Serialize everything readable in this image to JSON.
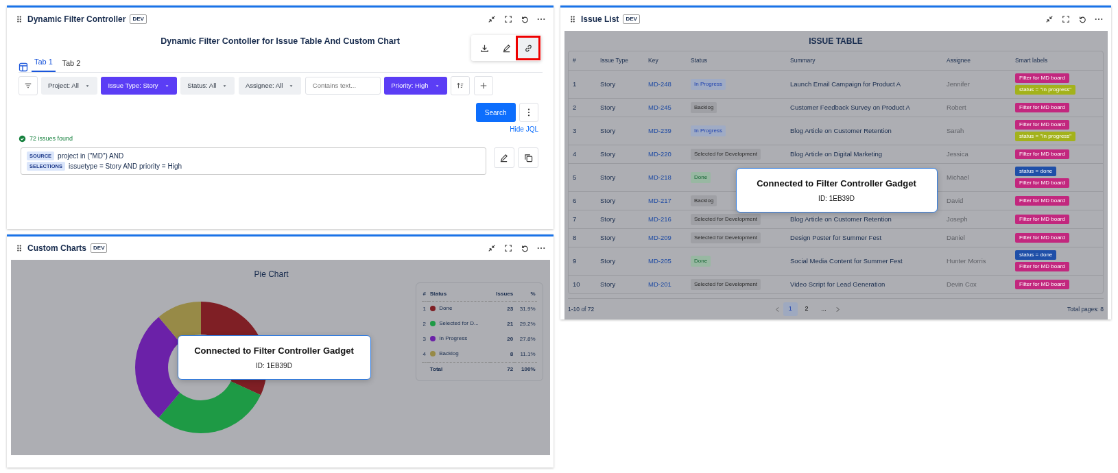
{
  "filter_panel": {
    "title": "Dynamic Filter Controller",
    "badge": "DEV",
    "heading": "Dynamic Filter Contoller for Issue Table And Custom Chart",
    "toolbar_buttons": [
      {
        "kind": "download",
        "highlighted": false
      },
      {
        "kind": "edit",
        "highlighted": false
      },
      {
        "kind": "link",
        "highlighted": true
      }
    ],
    "tabs": [
      {
        "label": "Tab 1",
        "selected": true
      },
      {
        "label": "Tab 2",
        "selected": false
      }
    ],
    "filters": [
      {
        "kind": "dropdown",
        "label": "Project: All",
        "active": false
      },
      {
        "kind": "dropdown",
        "label": "Issue Type: Story",
        "active": true
      },
      {
        "kind": "dropdown",
        "label": "Status: All",
        "active": false
      },
      {
        "kind": "dropdown",
        "label": "Assignee: All",
        "active": false
      },
      {
        "kind": "text",
        "placeholder": "Contains text..."
      },
      {
        "kind": "dropdown",
        "label": "Priority: High",
        "active": true
      }
    ],
    "search_button": "Search",
    "hide_jql": "Hide JQL",
    "result": "72 issues found",
    "jql": [
      {
        "tag": "SOURCE",
        "text": "project in (\"MD\") AND"
      },
      {
        "tag": "SELECTIONS",
        "text": "issuetype = Story AND priority = High"
      }
    ]
  },
  "chart_panel": {
    "title": "Custom Charts",
    "badge": "DEV",
    "chart_data": {
      "type": "donut",
      "title": "Pie Chart",
      "categories": [
        "Done",
        "Selected for D...",
        "In Progress",
        "Backlog"
      ],
      "values": [
        31.9,
        29.2,
        27.8,
        11.1
      ]
    },
    "legend": {
      "columns": [
        "#",
        "Status",
        "Issues",
        "%"
      ],
      "rows": [
        {
          "n": "1",
          "issues": "23",
          "pct": "31.9%",
          "color": "#7f1f25"
        },
        {
          "n": "2",
          "issues": "21",
          "pct": "29.2%",
          "color": "#1e9a45"
        },
        {
          "n": "3",
          "issues": "20",
          "pct": "27.8%",
          "color": "#6b21a8"
        },
        {
          "n": "4",
          "issues": "8",
          "pct": "11.1%",
          "color": "#978a47"
        }
      ],
      "total": {
        "label": "Total",
        "issues": "72",
        "pct": "100%"
      }
    },
    "overlay": {
      "title": "Connected to Filter Controller Gadget",
      "id": "ID: 1EB39D"
    }
  },
  "issue_panel": {
    "title": "Issue List",
    "badge": "DEV",
    "table_title": "ISSUE TABLE",
    "columns": [
      "#",
      "Issue Type",
      "Key",
      "Status",
      "Summary",
      "Assignee",
      "Smart labels"
    ],
    "rows": [
      {
        "n": "1",
        "type": "Story",
        "key": "MD-248",
        "status": {
          "text": "In Progress",
          "kind": "progress"
        },
        "summary": "Launch Email Campaign for Product A",
        "assignee": "Jennifer",
        "labels": [
          {
            "text": "Filter for MD board",
            "color": "#c2277e"
          },
          {
            "text": "status = \"In progress\"",
            "color": "#a3b21b"
          }
        ]
      },
      {
        "n": "2",
        "type": "Story",
        "key": "MD-245",
        "status": {
          "text": "Backlog",
          "kind": "todo"
        },
        "summary": "Customer Feedback Survey on Product A",
        "assignee": "Robert",
        "labels": [
          {
            "text": "Filter for MD board",
            "color": "#c2277e"
          }
        ]
      },
      {
        "n": "3",
        "type": "Story",
        "key": "MD-239",
        "status": {
          "text": "In Progress",
          "kind": "progress"
        },
        "summary": "Blog Article on Customer Retention",
        "assignee": "Sarah",
        "labels": [
          {
            "text": "Filter for MD board",
            "color": "#c2277e"
          },
          {
            "text": "status = \"In progress\"",
            "color": "#a3b21b"
          }
        ]
      },
      {
        "n": "4",
        "type": "Story",
        "key": "MD-220",
        "status": {
          "text": "Selected for Development",
          "kind": "todo"
        },
        "summary": "Blog Article on Digital Marketing",
        "assignee": "Jessica",
        "labels": [
          {
            "text": "Filter for MD board",
            "color": "#c2277e"
          }
        ]
      },
      {
        "n": "5",
        "type": "Story",
        "key": "MD-218",
        "status": {
          "text": "Done",
          "kind": "done"
        },
        "assignee": "Michael",
        "labels": [
          {
            "text": "status = done",
            "color": "#1f4fa8"
          },
          {
            "text": "Filter for MD board",
            "color": "#c2277e"
          }
        ]
      },
      {
        "n": "6",
        "type": "Story",
        "key": "MD-217",
        "status": {
          "text": "Backlog",
          "kind": "todo"
        },
        "assignee": "David",
        "labels": [
          {
            "text": "Filter for MD board",
            "color": "#c2277e"
          }
        ]
      },
      {
        "n": "7",
        "type": "Story",
        "key": "MD-216",
        "status": {
          "text": "Selected for Development",
          "kind": "todo"
        },
        "summary": "Blog Article on Customer Retention",
        "assignee": "Joseph",
        "labels": [
          {
            "text": "Filter for MD board",
            "color": "#c2277e"
          }
        ]
      },
      {
        "n": "8",
        "type": "Story",
        "key": "MD-209",
        "status": {
          "text": "Selected for Development",
          "kind": "todo"
        },
        "summary": "Design Poster for Summer Fest",
        "assignee": "Daniel",
        "labels": [
          {
            "text": "Filter for MD board",
            "color": "#c2277e"
          }
        ]
      },
      {
        "n": "9",
        "type": "Story",
        "key": "MD-205",
        "status": {
          "text": "Done",
          "kind": "done"
        },
        "summary": "Social Media Content for Summer Fest",
        "assignee": "Hunter Morris",
        "labels": [
          {
            "text": "status = done",
            "color": "#1f4fa8"
          },
          {
            "text": "Filter for MD board",
            "color": "#c2277e"
          }
        ]
      },
      {
        "n": "10",
        "type": "Story",
        "key": "MD-201",
        "status": {
          "text": "Selected for Development",
          "kind": "todo"
        },
        "summary": "Video Script for Lead Generation",
        "assignee": "Devin Cox",
        "labels": [
          {
            "text": "Filter for MD board",
            "color": "#c2277e"
          }
        ]
      }
    ],
    "range": "1-10 of 72",
    "pages": [
      {
        "label": "1",
        "selected": true
      },
      {
        "label": "2",
        "selected": false
      },
      {
        "label": "...",
        "selected": false
      }
    ],
    "total_pages": "Total pages: 8",
    "overlay": {
      "title": "Connected to Filter Controller Gadget",
      "id": "ID: 1EB39D"
    }
  }
}
